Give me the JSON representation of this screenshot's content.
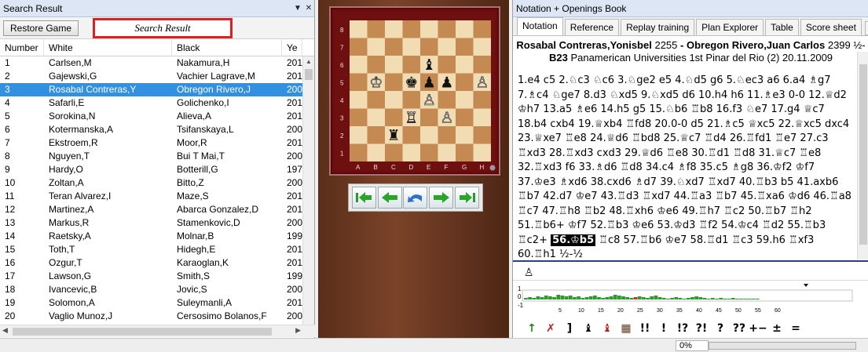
{
  "left_pane": {
    "title": "Search Result",
    "pin_icon": "pin-down-icon",
    "close_icon": "close-icon",
    "restore_button": "Restore Game",
    "search_field_value": "Search Result",
    "columns": [
      "Number",
      "White",
      "Black",
      "Ye"
    ],
    "rows": [
      {
        "n": "1",
        "white": "Carlsen,M",
        "black": "Nakamura,H",
        "year": "201"
      },
      {
        "n": "2",
        "white": "Gajewski,G",
        "black": "Vachier Lagrave,M",
        "year": "201"
      },
      {
        "n": "3",
        "white": "Rosabal Contreras,Y",
        "black": "Obregon Rivero,J",
        "year": "200"
      },
      {
        "n": "4",
        "white": "Safarli,E",
        "black": "Golichenko,I",
        "year": "201"
      },
      {
        "n": "5",
        "white": "Sorokina,N",
        "black": "Alieva,A",
        "year": "201"
      },
      {
        "n": "6",
        "white": "Kotermanska,A",
        "black": "Tsifanskaya,L",
        "year": "200"
      },
      {
        "n": "7",
        "white": "Ekstroem,R",
        "black": "Moor,R",
        "year": "201"
      },
      {
        "n": "8",
        "white": "Nguyen,T",
        "black": "Bui T Mai,T",
        "year": "200"
      },
      {
        "n": "9",
        "white": "Hardy,O",
        "black": "Botterill,G",
        "year": "197"
      },
      {
        "n": "10",
        "white": "Zoltan,A",
        "black": "Bitto,Z",
        "year": "200"
      },
      {
        "n": "11",
        "white": "Teran Alvarez,I",
        "black": "Maze,S",
        "year": "201"
      },
      {
        "n": "12",
        "white": "Martinez,A",
        "black": "Abarca Gonzalez,D",
        "year": "201"
      },
      {
        "n": "13",
        "white": "Markus,R",
        "black": "Stamenkovic,D",
        "year": "200"
      },
      {
        "n": "14",
        "white": "Raetsky,A",
        "black": "Molnar,B",
        "year": "199"
      },
      {
        "n": "15",
        "white": "Toth,T",
        "black": "Hidegh,E",
        "year": "201"
      },
      {
        "n": "16",
        "white": "Ozgur,T",
        "black": "Karaoglan,K",
        "year": "201"
      },
      {
        "n": "17",
        "white": "Lawson,G",
        "black": "Smith,S",
        "year": "199"
      },
      {
        "n": "18",
        "white": "Ivancevic,B",
        "black": "Jovic,S",
        "year": "200"
      },
      {
        "n": "19",
        "white": "Solomon,A",
        "black": "Suleymanli,A",
        "year": "201"
      },
      {
        "n": "20",
        "white": "Vaglio Munoz,J",
        "black": "Cersosimo Bolanos,F",
        "year": "200"
      }
    ],
    "selected_row": 2
  },
  "board": {
    "ranks": [
      "8",
      "7",
      "6",
      "5",
      "4",
      "3",
      "2",
      "1"
    ],
    "files": [
      "A",
      "B",
      "C",
      "D",
      "E",
      "F",
      "G",
      "H"
    ],
    "light_square": "#f2dcb4",
    "dark_square": "#c48a52",
    "pieces": [
      {
        "sq": "b5",
        "glyph": "♔",
        "color": "white"
      },
      {
        "sq": "d5",
        "glyph": "♚",
        "color": "black"
      },
      {
        "sq": "e6",
        "glyph": "♝",
        "color": "black"
      },
      {
        "sq": "e5",
        "glyph": "♟",
        "color": "black"
      },
      {
        "sq": "f5",
        "glyph": "♟",
        "color": "black"
      },
      {
        "sq": "h5",
        "glyph": "♙",
        "color": "white"
      },
      {
        "sq": "e4",
        "glyph": "♙",
        "color": "white"
      },
      {
        "sq": "d3",
        "glyph": "♖",
        "color": "white"
      },
      {
        "sq": "f3",
        "glyph": "♙",
        "color": "white"
      },
      {
        "sq": "c2",
        "glyph": "♜",
        "color": "black"
      }
    ],
    "nav_buttons": [
      {
        "name": "first-move-icon",
        "label": "|◀"
      },
      {
        "name": "previous-move-icon",
        "label": "◀"
      },
      {
        "name": "undo-move-icon",
        "label": "↶"
      },
      {
        "name": "next-move-icon",
        "label": "▶"
      },
      {
        "name": "last-move-icon",
        "label": "▶|"
      }
    ]
  },
  "right_pane": {
    "title": "Notation + Openings Book",
    "tabs": [
      "Notation",
      "Reference",
      "Replay training",
      "Plan Explorer",
      "Table",
      "Score sheet"
    ],
    "active_tab": 0,
    "header": {
      "white_player": "Rosabal Contreras,Yonisbel",
      "white_elo": "2255",
      "separator": " - ",
      "black_player": "Obregon Rivero,Juan Carlos",
      "black_elo": "2399",
      "result": "½-",
      "eco": "B23",
      "event": "Panamerican Universities 1st Pinar del Rio (2) 20.11.2009"
    },
    "notation_before": "1.e4 c5 2.♘c3 ♘c6 3.♘ge2 e5 4.♘d5 g6 5.♘ec3 a6 6.a4 ♗g7 7.♗c4 ♘ge7 8.d3 ♘xd5 9.♘xd5 d6 10.h4 h6 11.♗e3 0-0 12.♕d2 ♔h7 13.a5 ♗e6 14.h5 g5 15.♘b6 ♖b8 16.f3 ♘e7 17.g4 ♕c7 18.b4 cxb4 19.♕xb4 ♖fd8 20.0-0 d5 21.♗c5 ♕xc5 22.♕xc5 dxc4 23.♕xe7 ♖e8 24.♕d6 ♖bd8 25.♕c7 ♖d4 26.♖fd1 ♖e7 27.c3 ♖xd3 28.♖xd3 cxd3 29.♕d6 ♖e8 30.♖d1 ♖d8 31.♕c7 ♖e8 32.♖xd3 f6 33.♗d6 ♖d8 34.c4 ♗f8 35.c5 ♗g8 36.♔f2 ♔f7 37.♔e3 ♗xd6 38.cxd6 ♗d7 39.♘xd7 ♖xd7 40.♖b3 b5 41.axb6 ♖b7 42.d7 ♔e7 43.♖d3 ♖xd7 44.♖a3 ♖b7 45.♖xa6 ♔d6 46.♖a8 ♖c7 47.♖h8 ♖b2 48.♖xh6 ♔e6 49.♖h7 ♖c2 50.♖b7 ♖h2 51.♖b6+ ♔f7 52.♖b3 ♔e6 53.♔d3 ♖f2 54.♔c4 ♖d2 55.♖b3 ♖c2+",
    "notation_current": "56.♔b5",
    "notation_after": "♖c8 57.♖b6 ♔e7 58.♖d1 ♖c3 59.h6 ♖xf3 60.♖h1 ½-½",
    "strip_icon": "♙",
    "graph": {
      "y_labels": [
        "1",
        "0",
        "-1"
      ],
      "x_ticks": [
        "5",
        "10",
        "15",
        "20",
        "25",
        "30",
        "35",
        "40",
        "45",
        "50",
        "55",
        "60"
      ]
    },
    "eval_symbols": [
      "↑",
      "✗",
      "]",
      "♝",
      "♝",
      "▦",
      "!!",
      "!",
      "!?",
      "?!",
      "?",
      "??",
      "+−",
      "±",
      "="
    ]
  },
  "status_bar": {
    "progress_label": "0%",
    "progress": 0
  }
}
